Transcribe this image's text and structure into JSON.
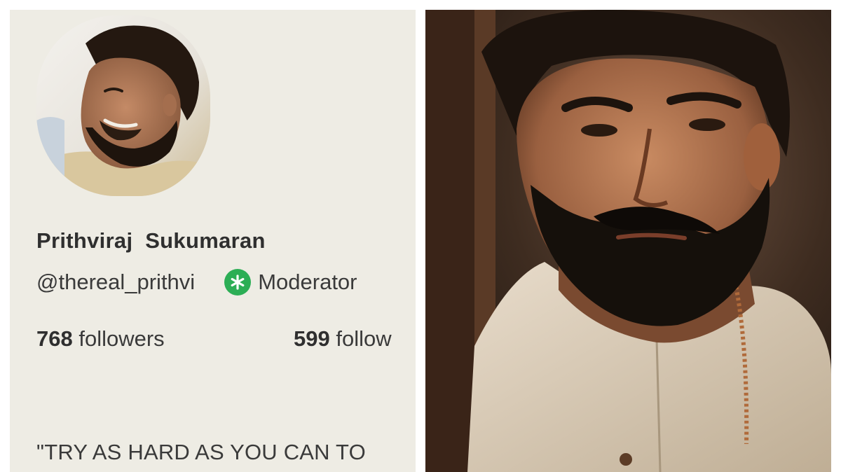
{
  "profile": {
    "display_name": "Prithviraj  Sukumaran",
    "handle": "@thereal_prithvi",
    "role_badge": "Moderator",
    "badge_icon": "asterisk-icon",
    "badge_color": "#2cae55",
    "stats": [
      {
        "count": "768",
        "label": "followers"
      },
      {
        "count": "599",
        "label": "follow"
      }
    ],
    "bio": "\"TRY AS HARD AS YOU CAN TO"
  },
  "colors": {
    "panel_background": "#eeece4",
    "text": "#3a3a3a"
  }
}
